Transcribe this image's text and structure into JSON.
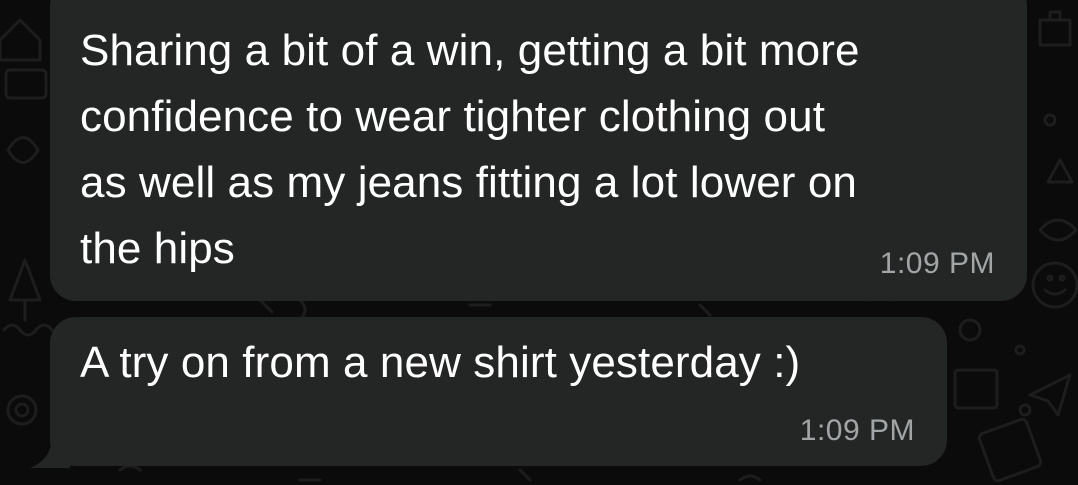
{
  "messages": [
    {
      "text": "Sharing a bit of a win, getting a bit more\nconfidence to wear tighter clothing out\nas well as my jeans fitting a lot lower on\nthe hips",
      "time": "1:09 PM"
    },
    {
      "text": "A try on from a new shirt yesterday :)",
      "time": "1:09 PM"
    }
  ],
  "colors": {
    "background": "#0b0b0b",
    "bubble": "#242626",
    "text": "#ffffff",
    "timestamp": "#a2a5a6",
    "doodle": "#1c1c1c"
  }
}
